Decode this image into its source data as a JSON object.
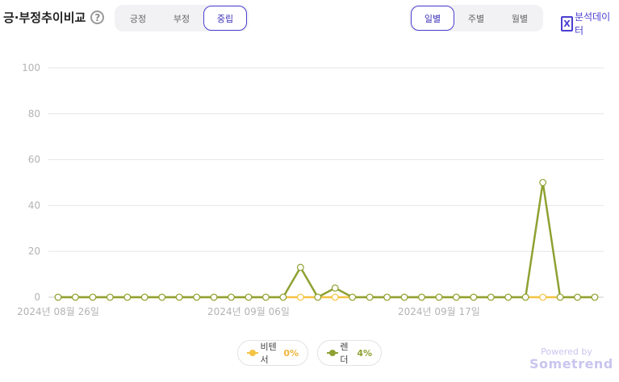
{
  "header": {
    "title": "긍·부정추이비교",
    "help_symbol": "?",
    "sentiment_tabs": [
      {
        "label": "긍정",
        "active": false
      },
      {
        "label": "부정",
        "active": false
      },
      {
        "label": "중립",
        "active": true
      }
    ],
    "period_tabs": [
      {
        "label": "일별",
        "active": true
      },
      {
        "label": "주별",
        "active": false
      },
      {
        "label": "월별",
        "active": false
      }
    ],
    "analysis_label": "분석데이터",
    "analysis_icon_glyph": "X"
  },
  "legend": {
    "items": [
      {
        "name": "비텐서",
        "pct": "0%"
      },
      {
        "name": "렌더",
        "pct": "4%"
      }
    ]
  },
  "footer": {
    "powered_by": "Powered by",
    "brand": "Sometrend"
  },
  "colors": {
    "accent": "#4b3fd1",
    "series_1": "#f5c342",
    "series_2": "#8ea132",
    "grid": "#e6e6e6",
    "axis_text": "#b3b3b3"
  },
  "chart_data": {
    "type": "line",
    "title": "",
    "xlabel": "",
    "ylabel": "",
    "ylim": [
      0,
      100
    ],
    "yticks": [
      0,
      20,
      40,
      60,
      80,
      100
    ],
    "grid": true,
    "legend_placement": "bottom-center",
    "x": [
      "2024-08-26",
      "2024-08-27",
      "2024-08-28",
      "2024-08-29",
      "2024-08-30",
      "2024-08-31",
      "2024-09-01",
      "2024-09-02",
      "2024-09-03",
      "2024-09-04",
      "2024-09-05",
      "2024-09-06",
      "2024-09-07",
      "2024-09-08",
      "2024-09-09",
      "2024-09-10",
      "2024-09-11",
      "2024-09-12",
      "2024-09-13",
      "2024-09-14",
      "2024-09-15",
      "2024-09-16",
      "2024-09-17",
      "2024-09-18",
      "2024-09-19",
      "2024-09-20",
      "2024-09-21",
      "2024-09-22",
      "2024-09-23",
      "2024-09-24",
      "2024-09-25",
      "2024-09-26"
    ],
    "x_tick_labels": [
      {
        "x": "2024-08-26",
        "label": "2024년 08월 26일"
      },
      {
        "x": "2024-09-06",
        "label": "2024년 09월 06일"
      },
      {
        "x": "2024-09-17",
        "label": "2024년 09월 17일"
      }
    ],
    "series": [
      {
        "name": "비텐서",
        "values": [
          0,
          0,
          0,
          0,
          0,
          0,
          0,
          0,
          0,
          0,
          0,
          0,
          0,
          0,
          0,
          0,
          0,
          0,
          0,
          0,
          0,
          0,
          0,
          0,
          0,
          0,
          0,
          0,
          0,
          0,
          0,
          0
        ]
      },
      {
        "name": "렌더",
        "values": [
          0,
          0,
          0,
          0,
          0,
          0,
          0,
          0,
          0,
          0,
          0,
          0,
          0,
          0,
          13,
          0,
          4,
          0,
          0,
          0,
          0,
          0,
          0,
          0,
          0,
          0,
          0,
          0,
          50,
          0,
          0,
          0
        ]
      }
    ]
  }
}
